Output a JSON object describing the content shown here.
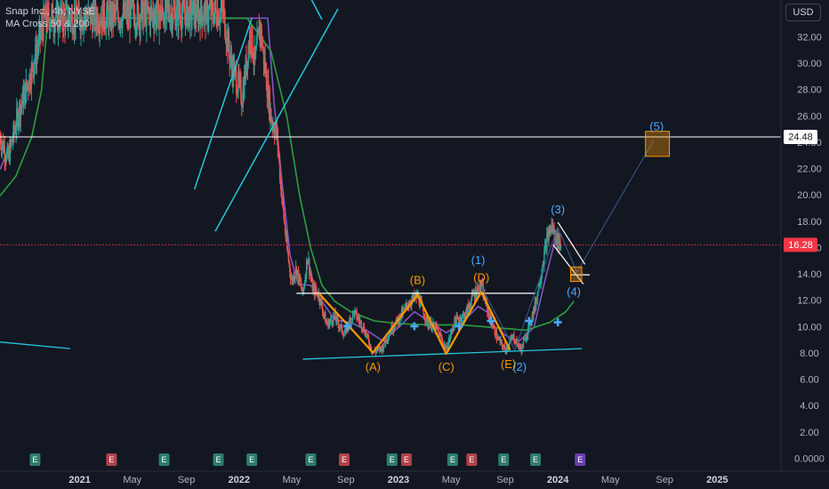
{
  "header": {
    "symbol_line": "Snap Inc., 4h, NYSE",
    "indicator_line": "MA Cross 50 & 200",
    "currency": "USD"
  },
  "colors": {
    "background": "#131722",
    "price_label_last": "#f23645",
    "price_label_level": "#ffffff",
    "wave_orange": "#ff9800",
    "wave_blue": "#4aa8ff",
    "ma50": "#7e57c2",
    "ma200": "#2e9e3f",
    "trendline": "#26c6da",
    "candle_up": "#26a69a",
    "candle_down": "#ef5350",
    "event_green": "#2e7d6b",
    "event_red": "#b2424a",
    "event_purple": "#6a3fb0"
  },
  "chart_data": {
    "type": "candlestick",
    "y_axis": {
      "min": 0,
      "max": 33,
      "tick_labels": [
        "32.00",
        "30.00",
        "28.00",
        "26.00",
        "24.00",
        "22.00",
        "20.00",
        "18.00",
        "16.00",
        "14.00",
        "12.00",
        "10.00",
        "8.00",
        "6.00",
        "4.00",
        "2.00",
        "0.0000"
      ],
      "tick_values": [
        32,
        30,
        28,
        26,
        24,
        22,
        20,
        18,
        16,
        14,
        12,
        10,
        8,
        6,
        4,
        2,
        0
      ]
    },
    "x_axis": {
      "start": 2020.5,
      "end": 2025.4,
      "tick_labels": [
        "2021",
        "May",
        "Sep",
        "2022",
        "May",
        "Sep",
        "2023",
        "May",
        "Sep",
        "2024",
        "May",
        "Sep",
        "2025"
      ],
      "tick_values": [
        2021.0,
        2021.33,
        2021.67,
        2022.0,
        2022.33,
        2022.67,
        2023.0,
        2023.33,
        2023.67,
        2024.0,
        2024.33,
        2024.67,
        2025.0
      ],
      "bold_labels": [
        "2021",
        "2022",
        "2023",
        "2024",
        "2025"
      ]
    },
    "price_labels": [
      {
        "text": "24.48",
        "value": 24.48,
        "style": "level"
      },
      {
        "text": "16.28",
        "value": 16.28,
        "style": "last"
      }
    ],
    "horizontal_lines": [
      {
        "value": 24.48,
        "color": "#ffffff",
        "from": 2020.5,
        "to": 2025.4
      },
      {
        "value": 16.28,
        "color": "#f23645",
        "dotted": true,
        "from": 2020.5,
        "to": 2025.4
      }
    ],
    "price_path": [
      [
        2020.5,
        24.5
      ],
      [
        2020.55,
        22.8
      ],
      [
        2020.62,
        26.5
      ],
      [
        2020.7,
        29.5
      ],
      [
        2020.78,
        33.5
      ],
      [
        2021.9,
        34.0
      ],
      [
        2021.95,
        30.0
      ],
      [
        2022.02,
        27.5
      ],
      [
        2022.07,
        32.5
      ],
      [
        2022.1,
        30.0
      ],
      [
        2022.13,
        33.0
      ],
      [
        2022.17,
        29.0
      ],
      [
        2022.2,
        26.0
      ],
      [
        2022.24,
        24.5
      ],
      [
        2022.26,
        21.0
      ],
      [
        2022.3,
        16.0
      ],
      [
        2022.33,
        13.5
      ],
      [
        2022.36,
        14.5
      ],
      [
        2022.4,
        12.5
      ],
      [
        2022.43,
        15.5
      ],
      [
        2022.46,
        13.0
      ],
      [
        2022.5,
        12.5
      ],
      [
        2022.55,
        10.2
      ],
      [
        2022.6,
        10.8
      ],
      [
        2022.66,
        9.5
      ],
      [
        2022.72,
        11.2
      ],
      [
        2022.78,
        10.0
      ],
      [
        2022.84,
        8.1
      ],
      [
        2022.9,
        8.5
      ],
      [
        2022.95,
        9.8
      ],
      [
        2023.0,
        10.6
      ],
      [
        2023.06,
        11.8
      ],
      [
        2023.12,
        12.4
      ],
      [
        2023.18,
        10.4
      ],
      [
        2023.24,
        9.9
      ],
      [
        2023.3,
        8.3
      ],
      [
        2023.35,
        10.4
      ],
      [
        2023.42,
        11.0
      ],
      [
        2023.47,
        12.5
      ],
      [
        2023.52,
        13.2
      ],
      [
        2023.57,
        10.8
      ],
      [
        2023.62,
        9.2
      ],
      [
        2023.67,
        8.3
      ],
      [
        2023.72,
        9.3
      ],
      [
        2023.77,
        8.3
      ],
      [
        2023.82,
        10.1
      ],
      [
        2023.86,
        11.8
      ],
      [
        2023.9,
        14.5
      ],
      [
        2023.93,
        16.6
      ],
      [
        2023.96,
        17.7
      ],
      [
        2023.99,
        16.8
      ],
      [
        2024.02,
        16.28
      ]
    ],
    "series": [
      {
        "name": "MA 50",
        "color": "#7e57c2",
        "points": [
          [
            2020.5,
            22.0
          ],
          [
            2020.6,
            25.0
          ],
          [
            2020.7,
            29.5
          ],
          [
            2020.78,
            33.5
          ],
          [
            2022.18,
            33.5
          ],
          [
            2022.22,
            27.0
          ],
          [
            2022.27,
            21.0
          ],
          [
            2022.32,
            15.5
          ],
          [
            2022.37,
            13.3
          ],
          [
            2022.45,
            13.2
          ],
          [
            2022.52,
            12.0
          ],
          [
            2022.6,
            10.6
          ],
          [
            2022.7,
            10.4
          ],
          [
            2022.8,
            9.8
          ],
          [
            2022.9,
            9.0
          ],
          [
            2023.0,
            10.0
          ],
          [
            2023.1,
            11.2
          ],
          [
            2023.2,
            10.4
          ],
          [
            2023.3,
            9.6
          ],
          [
            2023.4,
            10.4
          ],
          [
            2023.5,
            11.6
          ],
          [
            2023.58,
            11.0
          ],
          [
            2023.66,
            9.5
          ],
          [
            2023.75,
            8.9
          ],
          [
            2023.85,
            10.0
          ],
          [
            2023.92,
            13.6
          ],
          [
            2023.98,
            16.5
          ],
          [
            2024.02,
            16.3
          ]
        ]
      },
      {
        "name": "MA 200",
        "color": "#2e9e3f",
        "points": [
          [
            2020.5,
            20.0
          ],
          [
            2020.6,
            21.5
          ],
          [
            2020.7,
            24.5
          ],
          [
            2020.76,
            28.0
          ],
          [
            2020.8,
            33.5
          ],
          [
            2022.05,
            33.5
          ],
          [
            2022.2,
            31.0
          ],
          [
            2022.3,
            26.0
          ],
          [
            2022.38,
            20.0
          ],
          [
            2022.45,
            16.0
          ],
          [
            2022.52,
            13.2
          ],
          [
            2022.6,
            12.0
          ],
          [
            2022.7,
            11.2
          ],
          [
            2022.85,
            10.5
          ],
          [
            2023.0,
            10.3
          ],
          [
            2023.2,
            10.2
          ],
          [
            2023.4,
            10.2
          ],
          [
            2023.6,
            10.0
          ],
          [
            2023.8,
            9.8
          ],
          [
            2023.95,
            10.4
          ],
          [
            2024.05,
            11.2
          ],
          [
            2024.1,
            12.0
          ]
        ]
      }
    ],
    "wave_points_orange": [
      [
        2022.5,
        12.6
      ],
      [
        2022.84,
        8.1
      ],
      [
        2023.12,
        12.5
      ],
      [
        2023.3,
        8.0
      ],
      [
        2023.52,
        12.7
      ],
      [
        2023.7,
        8.3
      ]
    ],
    "wave_points_blue": [
      [
        2023.52,
        13.1
      ],
      [
        2023.73,
        8.3
      ],
      [
        2024.0,
        17.6
      ],
      [
        2024.12,
        14.2
      ],
      [
        2024.6,
        24.2
      ]
    ],
    "wave_labels": [
      {
        "text": "(A)",
        "x": 2022.84,
        "y": 6.95,
        "group": "orange"
      },
      {
        "text": "(B)",
        "x": 2023.12,
        "y": 13.55,
        "group": "orange"
      },
      {
        "text": "(C)",
        "x": 2023.3,
        "y": 6.95,
        "group": "orange"
      },
      {
        "text": "(D)",
        "x": 2023.52,
        "y": 13.75,
        "group": "orange"
      },
      {
        "text": "(E)",
        "x": 2023.69,
        "y": 7.15,
        "group": "orange"
      },
      {
        "text": "(1)",
        "x": 2023.5,
        "y": 15.05,
        "group": "blue"
      },
      {
        "text": "(2)",
        "x": 2023.76,
        "y": 6.95,
        "group": "blue"
      },
      {
        "text": "(3)",
        "x": 2024.0,
        "y": 18.9,
        "group": "blue"
      },
      {
        "text": "(4)",
        "x": 2024.1,
        "y": 12.65,
        "group": "blue"
      },
      {
        "text": "(5)",
        "x": 2024.62,
        "y": 25.2,
        "group": "blue"
      }
    ],
    "support_resistance": [
      {
        "from": [
          2022.36,
          12.6
        ],
        "to": [
          2023.86,
          12.6
        ],
        "color": "#ffffff"
      },
      {
        "from": [
          2022.4,
          7.6
        ],
        "to": [
          2024.15,
          8.4
        ],
        "color": "#26c6da"
      },
      {
        "from": [
          2020.5,
          8.9
        ],
        "to": [
          2020.94,
          8.4
        ],
        "color": "#26c6da"
      }
    ],
    "trend_lines": [
      {
        "from": [
          2021.72,
          20.5
        ],
        "to": [
          2022.08,
          33.5
        ],
        "color": "#26c6da"
      },
      {
        "from": [
          2021.85,
          17.3
        ],
        "to": [
          2022.62,
          34.2
        ],
        "color": "#26c6da"
      },
      {
        "from": [
          2022.45,
          35.0
        ],
        "to": [
          2022.52,
          33.4
        ],
        "color": "#26c6da"
      }
    ],
    "channel_lines": [
      {
        "from": [
          2024.0,
          18.0
        ],
        "to": [
          2024.17,
          14.8
        ],
        "color": "#ffffff"
      },
      {
        "from": [
          2023.97,
          16.3
        ],
        "to": [
          2024.16,
          13.3
        ],
        "color": "#ffffff"
      },
      {
        "from": [
          2024.08,
          14.0
        ],
        "to": [
          2024.2,
          14.0
        ],
        "color": "#ffffff"
      }
    ],
    "target_boxes": [
      {
        "x1": 2024.55,
        "x2": 2024.7,
        "y1": 23.0,
        "y2": 24.9,
        "color": "#ff9800"
      },
      {
        "x1": 2024.08,
        "x2": 2024.15,
        "y1": 13.5,
        "y2": 14.6,
        "color": "#ff9800"
      }
    ],
    "cross_markers": [
      [
        2022.68,
        10.1
      ],
      [
        2023.1,
        10.1
      ],
      [
        2023.38,
        10.1
      ],
      [
        2023.58,
        10.5
      ],
      [
        2023.82,
        10.5
      ],
      [
        2024.0,
        10.4
      ]
    ],
    "event_markers": [
      {
        "x": 2020.72,
        "kind": "green"
      },
      {
        "x": 2021.2,
        "kind": "red"
      },
      {
        "x": 2021.53,
        "kind": "green"
      },
      {
        "x": 2021.87,
        "kind": "green"
      },
      {
        "x": 2022.08,
        "kind": "green"
      },
      {
        "x": 2022.45,
        "kind": "green"
      },
      {
        "x": 2022.66,
        "kind": "red"
      },
      {
        "x": 2022.96,
        "kind": "green"
      },
      {
        "x": 2023.05,
        "kind": "red"
      },
      {
        "x": 2023.34,
        "kind": "green"
      },
      {
        "x": 2023.46,
        "kind": "red"
      },
      {
        "x": 2023.66,
        "kind": "green"
      },
      {
        "x": 2023.86,
        "kind": "green"
      },
      {
        "x": 2024.14,
        "kind": "purple"
      }
    ],
    "event_letter": "E"
  }
}
